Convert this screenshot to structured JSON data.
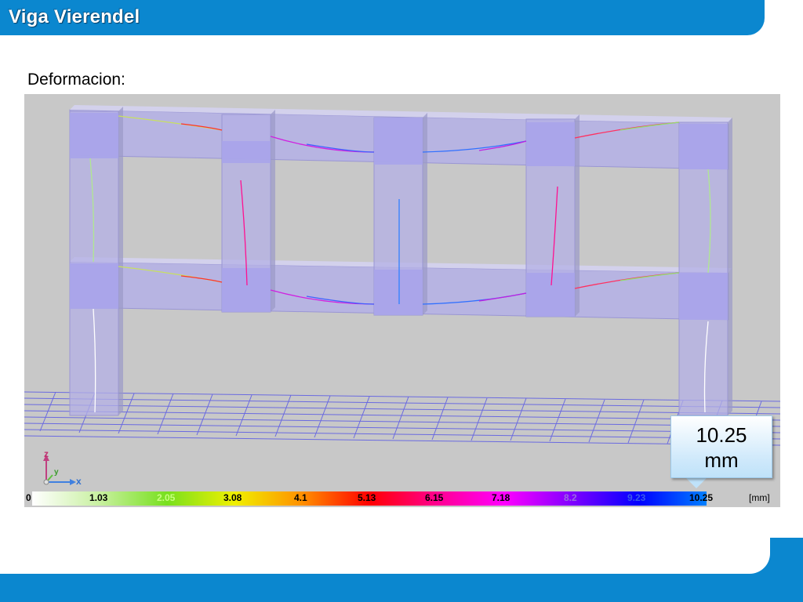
{
  "header": {
    "title": "Viga Vierendel"
  },
  "section": {
    "label": "Deformacion:"
  },
  "callout": {
    "value": "10.25",
    "unit": "mm"
  },
  "axes": {
    "z": "z",
    "y": "y",
    "x": "x"
  },
  "legend": {
    "ticks": [
      "0",
      "1.03",
      "2.05",
      "3.08",
      "4.1",
      "5.13",
      "6.15",
      "7.18",
      "8.2",
      "9.23",
      "10.25"
    ],
    "unit": "[mm]"
  },
  "colors": {
    "brand": "#0b87cf",
    "member_fill": "#b4b0e6",
    "mesh": "#6a6ae0",
    "viewport_bg": "#c8c8c8"
  }
}
